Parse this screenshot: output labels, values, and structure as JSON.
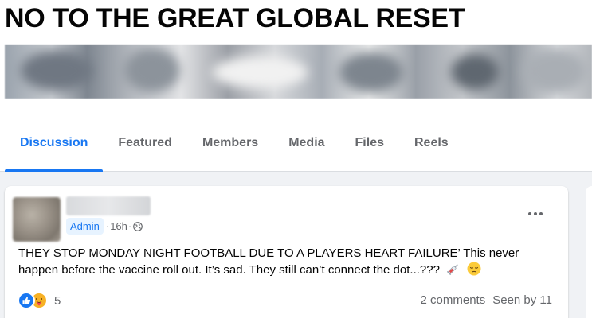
{
  "group": {
    "title": "NO TO THE GREAT GLOBAL RESET"
  },
  "tabs": [
    {
      "label": "Discussion",
      "active": true
    },
    {
      "label": "Featured",
      "active": false
    },
    {
      "label": "Members",
      "active": false
    },
    {
      "label": "Media",
      "active": false
    },
    {
      "label": "Files",
      "active": false
    },
    {
      "label": "Reels",
      "active": false
    }
  ],
  "post": {
    "role_badge": "Admin",
    "time": "16h",
    "separator": "·",
    "visibility_icon": "globe-icon",
    "text": "THEY STOP MONDAY NIGHT FOOTBALL DUE TO A PLAYERS HEART FAILURE’ This never happen before the vaccine roll out. It’s sad. They still  can’t connect the dot...???",
    "emojis": [
      "syringe-icon",
      "pensive-face-icon"
    ],
    "reactions": {
      "icons": [
        "like-icon",
        "care-icon"
      ],
      "count": "5"
    },
    "comments": "2 comments",
    "seen_by": "Seen by 11"
  },
  "colors": {
    "accent": "#1877f2",
    "secondary_text": "#65676b",
    "background": "#f0f2f5"
  }
}
